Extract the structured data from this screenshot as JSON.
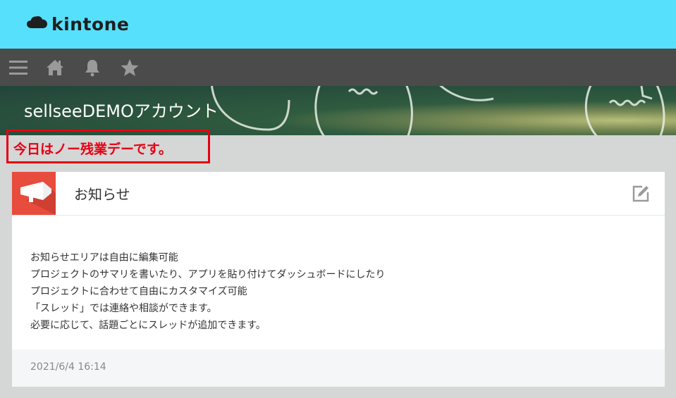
{
  "header": {
    "logo_text": "kintone",
    "logo_icon": "cloud-icon",
    "bg_color": "#56e0fb"
  },
  "nav": {
    "items": [
      {
        "icon": "menu-icon"
      },
      {
        "icon": "home-icon"
      },
      {
        "icon": "bell-icon"
      },
      {
        "icon": "star-icon"
      }
    ],
    "bg_color": "#4b4b4b"
  },
  "space": {
    "title": "sellseeDEMOアカウント"
  },
  "notice": {
    "text": "今日はノー残業デーです。",
    "color": "#e60012"
  },
  "announcement": {
    "icon": "megaphone-icon",
    "title": "お知らせ",
    "edit_icon": "edit-icon",
    "lines": [
      "お知らせエリアは自由に編集可能",
      "プロジェクトのサマリを書いたり、アプリを貼り付けてダッシュボードにしたり",
      "プロジェクトに合わせて自由にカスタマイズ可能",
      "「スレッド」では連絡や相談ができます。",
      "必要に応じて、話題ごとにスレッドが追加できます。"
    ],
    "timestamp": "2021/6/4 16:14",
    "accent_color": "#e74c3c"
  }
}
